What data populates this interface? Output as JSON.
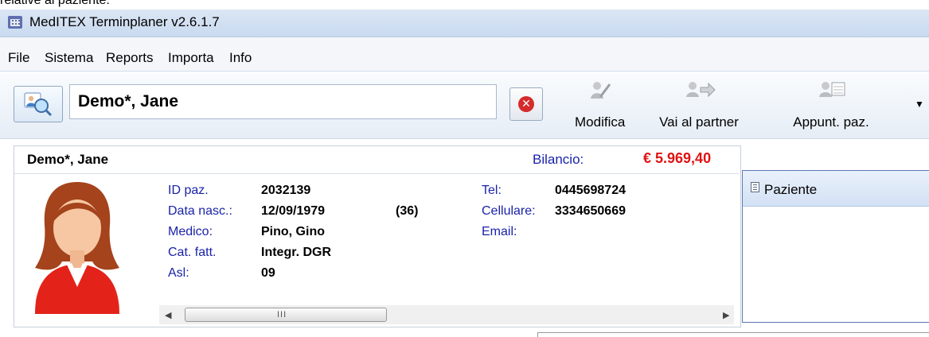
{
  "caption": "relative al paziente.",
  "window": {
    "title": "MedITEX Terminplaner  v2.6.1.7"
  },
  "menu": [
    "File",
    "Sistema",
    "Reports",
    "Importa",
    "Info"
  ],
  "toolbar": {
    "patient_value": "Demo*, Jane",
    "buttons": {
      "edit": "Modifica",
      "partner": "Vai al partner",
      "appointments": "Appunt. paz."
    }
  },
  "patient": {
    "name": "Demo*, Jane",
    "balance_label": "Bilancio:",
    "balance_value": "€ 5.969,40",
    "fields": {
      "id_label": "ID paz.",
      "id_value": "2032139",
      "dob_label": "Data nasc.:",
      "dob_value": "12/09/1979",
      "age": "(36)",
      "doctor_label": "Medico:",
      "doctor_value": "Pino, Gino",
      "billing_label": "Cat. fatt.",
      "billing_value": "Integr. DGR",
      "asl_label": "Asl:",
      "asl_value": "09",
      "tel_label": "Tel:",
      "tel_value": "0445698724",
      "mobile_label": "Cellulare:",
      "mobile_value": "3334650669",
      "email_label": "Email:"
    }
  },
  "side_panel": {
    "title": "Paziente"
  },
  "icons": [
    "app-icon",
    "search-patient-icon",
    "clear-icon",
    "edit-icon",
    "partner-icon",
    "appointments-icon",
    "avatar",
    "list-icon",
    "chevron-down-icon"
  ],
  "colors": {
    "balance": "#e01313",
    "label": "#1a23a8",
    "titlebar": "#c9daf0"
  }
}
